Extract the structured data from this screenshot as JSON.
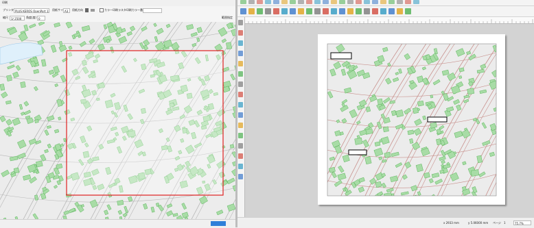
{
  "left_panel": {
    "title": "印刷",
    "toolbar1": {
      "printer_label": "プリンタ",
      "printer_value": "PLUS KEROS OpenPort 1286",
      "paper_size_label": "用紙サイズ",
      "paper_size_value": "A3",
      "orientation_label": "用紙方向",
      "color_print_label": "カラー印刷",
      "extra_label_1": "ラスタ印刷",
      "extra_label_2": "カラー番号"
    },
    "toolbar2": {
      "scale_label": "縮尺",
      "scale_value": "1/ 2500",
      "rotation_label": "角度(度)",
      "rotation_value": "0",
      "right_label": "範囲指定"
    }
  },
  "right_panel": {
    "toolbar_icon_names": [
      "zoom-in-icon",
      "zoom-out-icon",
      "zoom-full-icon",
      "zoom-page-icon",
      "refresh-icon",
      "add-page-icon",
      "duplicate-icon",
      "save-icon",
      "print-icon",
      "export-image-icon",
      "export-pdf-icon",
      "export-svg-icon",
      "settings-icon",
      "lock-icon",
      "map-icon",
      "legend-icon",
      "label-icon",
      "scale-bar-icon",
      "north-arrow-icon",
      "table-icon",
      "shape-icon"
    ],
    "tool_icon_names": [
      "hand-icon",
      "select-icon",
      "move-icon",
      "zoom-tool-icon",
      "add-map-icon",
      "add-image-icon",
      "add-text-icon",
      "add-legend-icon",
      "add-scalebar-icon",
      "add-shape-icon",
      "add-arrow-icon",
      "add-node-icon",
      "add-table-icon",
      "add-html-icon",
      "edit-nodes-icon",
      "move-content-icon"
    ],
    "status": {
      "x": "x 2933 mm",
      "y": "y 5.06000 mm",
      "page_label": "ページ",
      "page_value": "1",
      "zoom": "75.7%"
    }
  },
  "colors": {
    "building_fill": "#a8dca6",
    "building_stroke": "#4fae4f",
    "road_line": "#b7b7b7",
    "road_line_red": "#c8908c",
    "selection_red": "#e02020",
    "water": "#dff0fb",
    "accent_button": "#2f7fd9"
  }
}
